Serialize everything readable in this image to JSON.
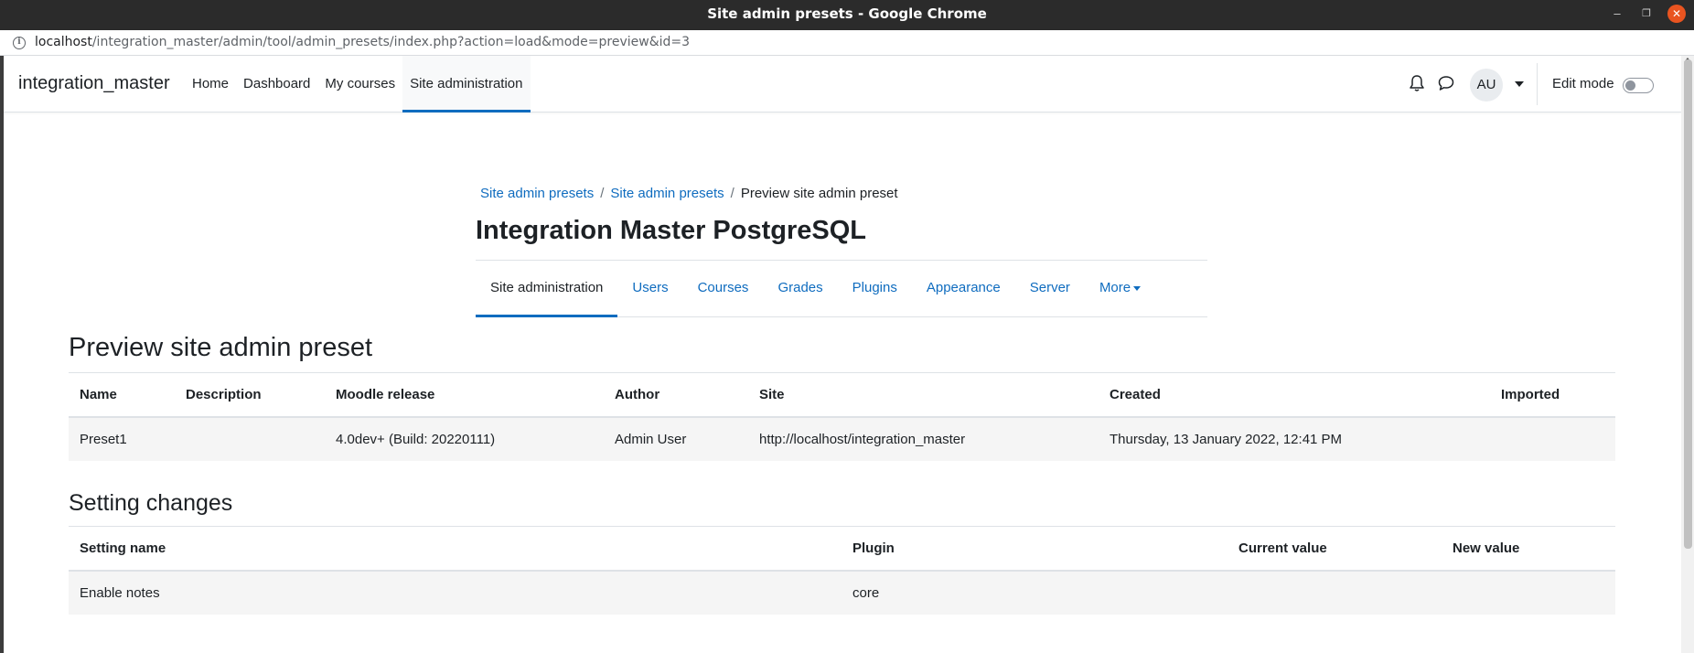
{
  "window": {
    "title": "Site admin presets - Google Chrome",
    "minimize_glyph": "–",
    "restore_glyph": "❐",
    "close_glyph": "✕"
  },
  "addressbar": {
    "info_glyph": "i",
    "url_host": "localhost",
    "url_path": "/integration_master/admin/tool/admin_presets/index.php?action=load&mode=preview&id=3"
  },
  "navbar": {
    "brand": "integration_master",
    "items": [
      {
        "label": "Home"
      },
      {
        "label": "Dashboard"
      },
      {
        "label": "My courses"
      },
      {
        "label": "Site administration"
      }
    ],
    "avatar_initials": "AU",
    "edit_mode_label": "Edit mode"
  },
  "breadcrumb": {
    "items": [
      "Site admin presets",
      "Site admin presets"
    ],
    "separator": "/",
    "current": "Preview site admin preset"
  },
  "page_title": "Integration Master PostgreSQL",
  "secondary_nav": {
    "tabs": [
      {
        "label": "Site administration"
      },
      {
        "label": "Users"
      },
      {
        "label": "Courses"
      },
      {
        "label": "Grades"
      },
      {
        "label": "Plugins"
      },
      {
        "label": "Appearance"
      },
      {
        "label": "Server"
      },
      {
        "label": "More"
      }
    ]
  },
  "preview": {
    "heading": "Preview site admin preset",
    "columns": [
      "Name",
      "Description",
      "Moodle release",
      "Author",
      "Site",
      "Created",
      "Imported"
    ],
    "row": [
      "Preset1",
      "",
      "4.0dev+ (Build: 20220111)",
      "Admin User",
      "http://localhost/integration_master",
      "Thursday, 13 January 2022, 12:41 PM",
      ""
    ]
  },
  "settings": {
    "heading": "Setting changes",
    "columns": [
      "Setting name",
      "Plugin",
      "Current value",
      "New value"
    ],
    "row": [
      "Enable notes",
      "core",
      "",
      ""
    ]
  },
  "colors": {
    "link": "#0f6cbf",
    "text": "#1d2125",
    "titlebar": "#2b2b2b",
    "close": "#e95420"
  }
}
